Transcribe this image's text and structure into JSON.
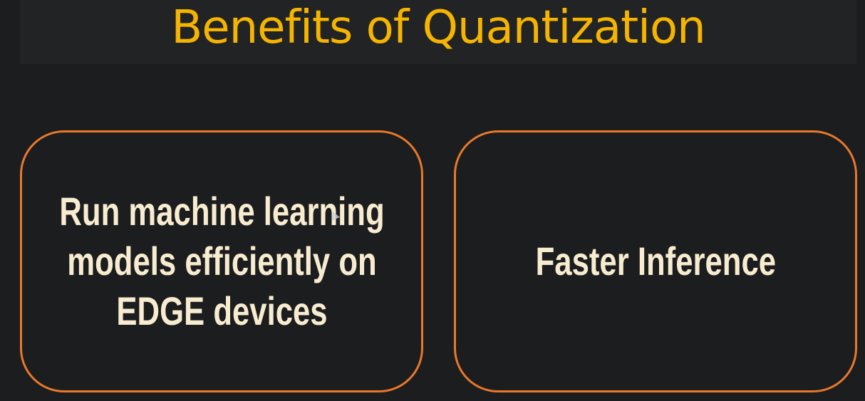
{
  "slide": {
    "title": "Benefits of Quantization",
    "cards": [
      {
        "lines": [
          "Run machine learning",
          "models efficiently on",
          "EDGE devices"
        ]
      },
      {
        "lines": [
          "Faster Inference"
        ]
      }
    ]
  },
  "colors": {
    "background": "#1c1d1f",
    "title": "#f5b400",
    "card_border": "#e8782a",
    "card_text": "#f8ecd0"
  },
  "icons": {
    "cursor": "mouse-pointer-icon"
  }
}
